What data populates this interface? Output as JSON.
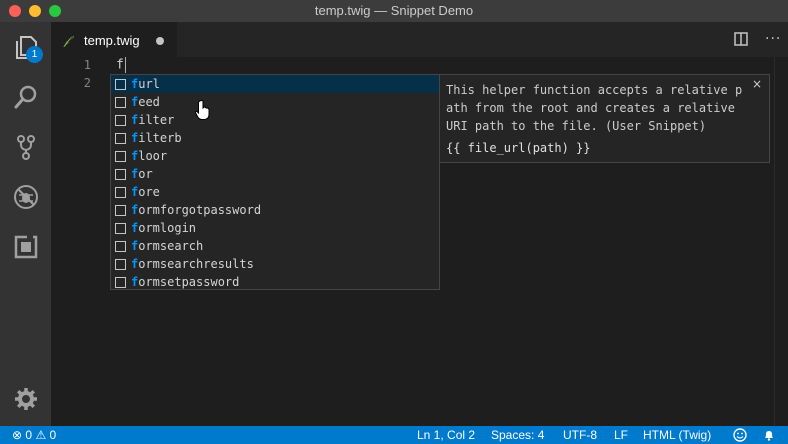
{
  "window": {
    "title": "temp.twig — Snippet Demo"
  },
  "activity_bar": {
    "explorer_badge": "1",
    "items": [
      "explorer-icon",
      "search-icon",
      "source-control-icon",
      "debug-icon",
      "extensions-icon",
      "settings-gear-icon"
    ]
  },
  "tabs": [
    {
      "label": "temp.twig",
      "dirty": true
    }
  ],
  "editor": {
    "line_numbers": [
      "1",
      "2"
    ],
    "lines": [
      "f",
      ""
    ]
  },
  "suggest": {
    "typed": "f",
    "items": [
      {
        "match": "f",
        "rest": "url"
      },
      {
        "match": "f",
        "rest": "eed"
      },
      {
        "match": "f",
        "rest": "ilter"
      },
      {
        "match": "f",
        "rest": "ilterb"
      },
      {
        "match": "f",
        "rest": "loor"
      },
      {
        "match": "f",
        "rest": "or"
      },
      {
        "match": "f",
        "rest": "ore"
      },
      {
        "match": "f",
        "rest": "ormforgotpassword"
      },
      {
        "match": "f",
        "rest": "ormlogin"
      },
      {
        "match": "f",
        "rest": "ormsearch"
      },
      {
        "match": "f",
        "rest": "ormsearchresults"
      },
      {
        "match": "f",
        "rest": "ormsetpassword"
      }
    ],
    "selected_index": 0
  },
  "details": {
    "description": "This helper function accepts a relative p\nath from the root and creates a relative\nURI path to the file. (User Snippet)",
    "code": "{{ file_url(path) }}",
    "close": "×"
  },
  "status_bar": {
    "errors": "0",
    "warnings": "0",
    "position": "Ln 1, Col 2",
    "spaces": "Spaces: 4",
    "encoding": "UTF-8",
    "eol": "LF",
    "language": "HTML (Twig)"
  },
  "colors": {
    "accent": "#007acc",
    "match_highlight": "#0097fb",
    "selected_row": "#062f4a"
  }
}
